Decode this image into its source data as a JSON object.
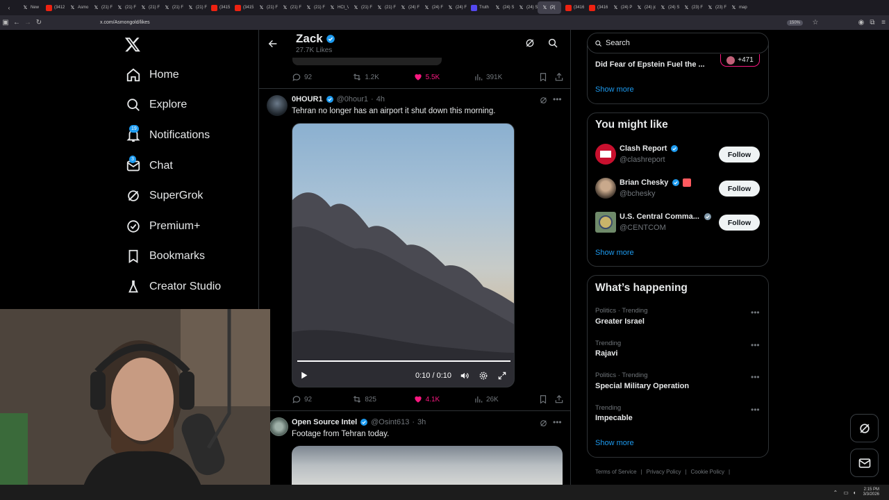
{
  "browser": {
    "tabs": [
      {
        "label": "New"
      },
      {
        "label": "(3412"
      },
      {
        "label": "Asmo"
      },
      {
        "label": "(21) F"
      },
      {
        "label": "(21) F"
      },
      {
        "label": "(21) F"
      },
      {
        "label": "(21) F"
      },
      {
        "label": "(21) F"
      },
      {
        "label": "(3415"
      },
      {
        "label": "(3415"
      },
      {
        "label": "(21) F"
      },
      {
        "label": "(21) F"
      },
      {
        "label": "(21) F"
      },
      {
        "label": "HCt_V"
      },
      {
        "label": "(21) F"
      },
      {
        "label": "(21) F"
      },
      {
        "label": "(24) F"
      },
      {
        "label": "(24) F"
      },
      {
        "label": "(24) F"
      },
      {
        "label": "Truth"
      },
      {
        "label": "(24) S"
      },
      {
        "label": "(24) S"
      },
      {
        "label": "(2("
      },
      {
        "label": "(3416"
      },
      {
        "label": "(3416"
      },
      {
        "label": "(24) P"
      },
      {
        "label": "(24) jc"
      },
      {
        "label": "(24) S"
      },
      {
        "label": "(23) F"
      },
      {
        "label": "(23) F"
      },
      {
        "label": "map"
      }
    ],
    "url": "x.com/Asmongold/likes",
    "zoom": "150%"
  },
  "nav": {
    "items": [
      {
        "label": "Home",
        "icon": "home-icon"
      },
      {
        "label": "Explore",
        "icon": "search-icon"
      },
      {
        "label": "Notifications",
        "icon": "bell-icon",
        "badge": "19"
      },
      {
        "label": "Chat",
        "icon": "mail-icon",
        "badge": "3"
      },
      {
        "label": "SuperGrok",
        "icon": "grok-icon"
      },
      {
        "label": "Premium+",
        "icon": "verified-icon"
      },
      {
        "label": "Bookmarks",
        "icon": "bookmark-icon"
      },
      {
        "label": "Creator Studio",
        "icon": "flask-icon"
      }
    ]
  },
  "header": {
    "name": "Zack",
    "subtitle": "27.7K Likes"
  },
  "tweets": [
    {
      "replies": "92",
      "reposts": "1.2K",
      "likes": "5.5K",
      "views": "391K"
    },
    {
      "name": "0HOUR1",
      "handle": "@0hour1",
      "time": "4h",
      "text": "Tehran no longer has an airport it shut down this morning.",
      "video_time": "0:10 / 0:10",
      "video_progress": 1.0,
      "replies": "92",
      "reposts": "825",
      "likes": "4.1K",
      "views": "26K"
    },
    {
      "name": "Open Source Intel",
      "handle": "@Osint613",
      "time": "3h",
      "text": "Footage from Tehran today."
    }
  ],
  "right": {
    "search_placeholder": "Search",
    "top_item": {
      "text": "Did Fear of Epstein Fuel the ...",
      "count": "+471"
    },
    "show_more": "Show more",
    "you_might_like": {
      "title": "You might like",
      "users": [
        {
          "name": "Clash Report",
          "handle": "@clashreport",
          "follow": "Follow"
        },
        {
          "name": "Brian Chesky",
          "handle": "@bchesky",
          "follow": "Follow"
        },
        {
          "name": "U.S. Central Comma...",
          "handle": "@CENTCOM",
          "follow": "Follow"
        }
      ],
      "show_more": "Show more"
    },
    "happening": {
      "title": "What’s happening",
      "trends": [
        {
          "meta": "Politics · Trending",
          "name": "Greater Israel"
        },
        {
          "meta": "Trending",
          "name": "Rajavi"
        },
        {
          "meta": "Politics · Trending",
          "name": "Special Military Operation"
        },
        {
          "meta": "Trending",
          "name": "Impecable"
        }
      ],
      "show_more": "Show more"
    },
    "footer": [
      "Terms of Service",
      "Privacy Policy",
      "Cookie Policy"
    ]
  },
  "taskbar": {
    "time": "2:15 PM",
    "date": "3/3/2026"
  },
  "colors": {
    "accent": "#1d9bf0",
    "like": "#f91880",
    "bg": "#000000",
    "border": "#2f3336"
  }
}
